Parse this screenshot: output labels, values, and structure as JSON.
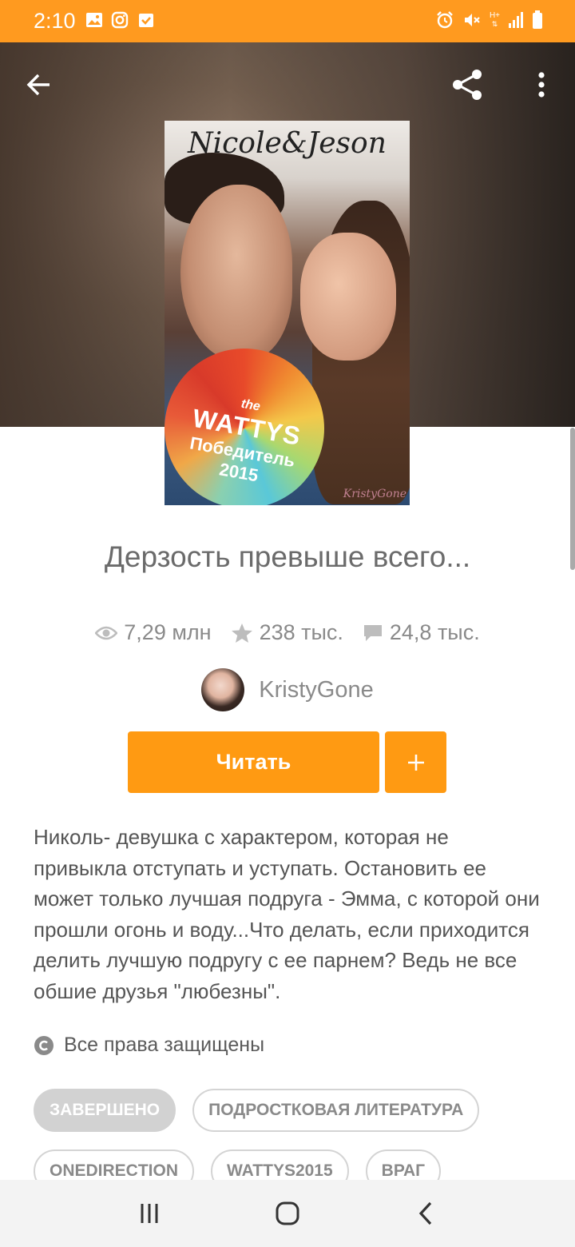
{
  "status_bar": {
    "time": "2:10",
    "left_icons": [
      "image-icon",
      "instagram-icon",
      "check-box-icon"
    ],
    "right_icons": [
      "alarm-icon",
      "mute-icon",
      "network-icon",
      "signal-icon",
      "battery-icon"
    ],
    "network_text": "H+",
    "color": "#ff9a1f"
  },
  "header": {
    "back_icon": "arrow-left-icon",
    "share_icon": "share-icon",
    "more_icon": "more-vertical-icon"
  },
  "cover": {
    "title": "Nicole&Jeson",
    "badge_the": "the",
    "badge_brand": "WATTYS",
    "badge_line1": "Победитель",
    "badge_line2": "2015",
    "signature": "KristyGone"
  },
  "story": {
    "title": "Дерзость превыше всего...",
    "stats": {
      "reads": "7,29 млн",
      "votes": "238 тыс.",
      "comments": "24,8 тыс."
    },
    "author": "KristyGone",
    "read_button": "Читать",
    "add_button": "+",
    "description": "Николь- девушка с характером, которая не привыкла отступать и уступать. Остановить ее может только лучшая подруга - Эмма, с которой они прошли огонь и воду...Что делать, если приходится делить лучшую подругу с ее парнем? Ведь не все обшие друзья \"любезны\".",
    "copyright": "Все права защищены",
    "tags_row1": [
      "ЗАВЕРШЕНО",
      "ПОДРОСТКОВАЯ ЛИТЕРАТУРА"
    ],
    "tags_row2": [
      "ONEDIRECTION",
      "WATTYS2015",
      "ВРАГ"
    ]
  },
  "colors": {
    "accent": "#ff9a12",
    "text_muted": "#8a8a8a"
  },
  "nav": {
    "icons": [
      "recents-icon",
      "home-icon",
      "back-icon"
    ]
  }
}
